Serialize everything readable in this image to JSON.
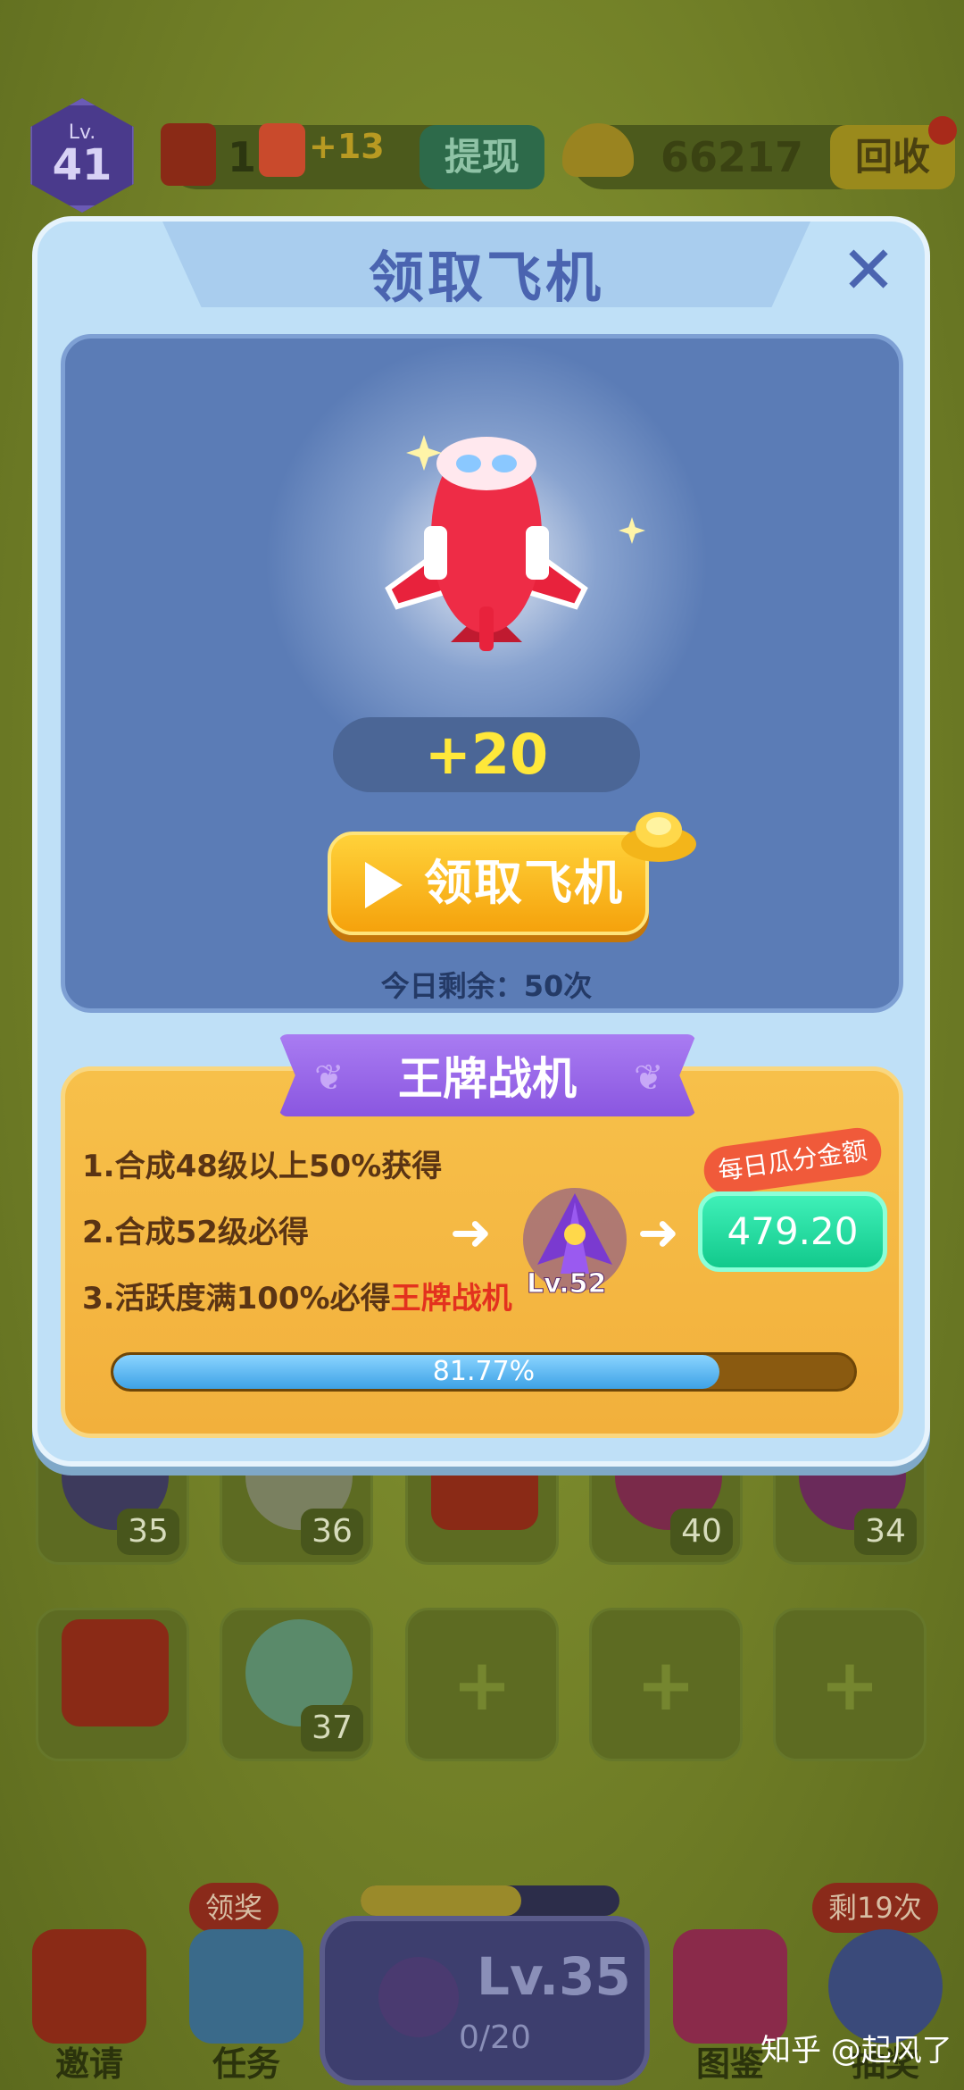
{
  "topbar": {
    "level_label": "Lv.",
    "level": "41",
    "cash_value": "1",
    "cash_suffix": "2",
    "plus_badge": "+13",
    "withdraw_label": "提现",
    "gold_value": "66217",
    "recycle_label": "回收"
  },
  "dialog": {
    "title": "领取飞机",
    "close_icon": "close-icon",
    "reward": "+20",
    "claim_button": "领取飞机",
    "remaining": "今日剩余：50次"
  },
  "ace": {
    "banner": "王牌战机",
    "rules": [
      {
        "text": "1.合成48级以上50%获得",
        "highlight": ""
      },
      {
        "text": "2.合成52级必得",
        "highlight": ""
      },
      {
        "text": "3.活跃度满100%必得",
        "highlight": "王牌战机"
      }
    ],
    "plane_level": "Lv.52",
    "tag": "每日瓜分金额",
    "amount": "479.20",
    "progress": 0.8177,
    "progress_text": "81.77%"
  },
  "grid": {
    "row1": [
      "35",
      "36",
      "",
      "40",
      "34"
    ],
    "row2": [
      "",
      "37",
      "",
      "",
      ""
    ]
  },
  "bottom": {
    "invite": "邀请",
    "tasks": "任务",
    "tasks_bubble": "领奖",
    "level": "Lv.35",
    "progress": "0/20",
    "progress_fraction": 0.62,
    "atlas": "图鉴",
    "lottery_bubble": "剩19次",
    "lottery": "抽奖"
  },
  "watermark": "知乎 @起风了",
  "colors": {
    "dialog_bg": "#bfe0f7",
    "reward_area": "#5b7cb6",
    "claim_button": "#f5a20c",
    "ace_panel": "#f2b03c",
    "money_box": "#12c98c",
    "progress_fill": "#3ea2e6"
  }
}
